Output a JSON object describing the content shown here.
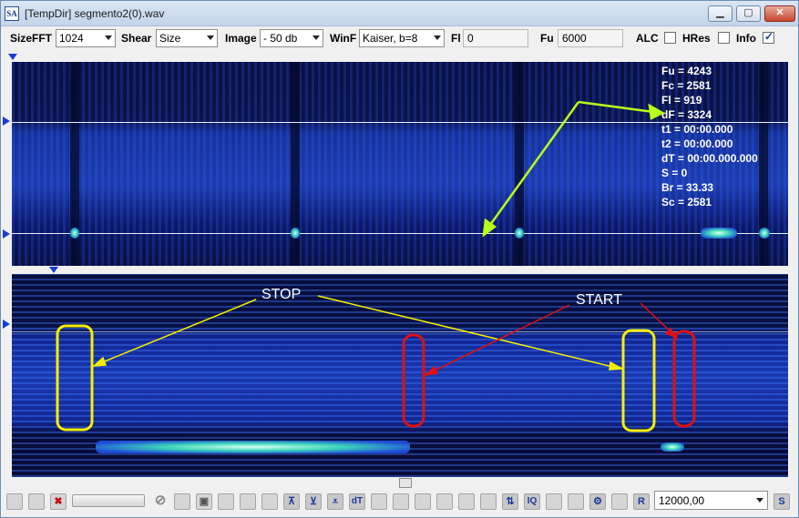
{
  "window": {
    "title": "[TempDir] segmento2(0).wav",
    "app_icon_text": "SA"
  },
  "toolbar": {
    "sizefft_label": "SizeFFT",
    "sizefft_value": "1024",
    "shear_label": "Shear",
    "shear_value": "Size",
    "image_label": "Image",
    "image_value": "- 50 db",
    "winf_label": "WinF",
    "winf_value": "Kaiser, b=8",
    "fl_label": "Fl",
    "fl_value": "0",
    "fu_label": "Fu",
    "fu_value": "6000",
    "alc_label": "ALC",
    "alc_checked": false,
    "hres_label": "HRes",
    "hres_checked": false,
    "info_label": "Info",
    "info_checked": true
  },
  "info": {
    "fu": "Fu = 4243",
    "fc": "Fc = 2581",
    "fl": "Fl = 919",
    "df": "dF = 3324",
    "t1": "t1 = 00:00.000",
    "t2": "t2 = 00:00.000",
    "dt": "dT = 00:00.000.000",
    "s": "S = 0",
    "br": "Br = 33.33",
    "sc": "Sc = 2581"
  },
  "annotations": {
    "stop": "STOP",
    "start": "START"
  },
  "bottom": {
    "rate_value": "12000,00",
    "btn_dt": "dT",
    "btn_iq": "IQ",
    "btn_r": "R",
    "btn_s": "S"
  },
  "colors": {
    "spectrum_blue": "#1b3cb8",
    "annotation_yellow": "#f5f000",
    "annotation_red": "#e01010",
    "annotation_green": "#b8ff1a"
  }
}
